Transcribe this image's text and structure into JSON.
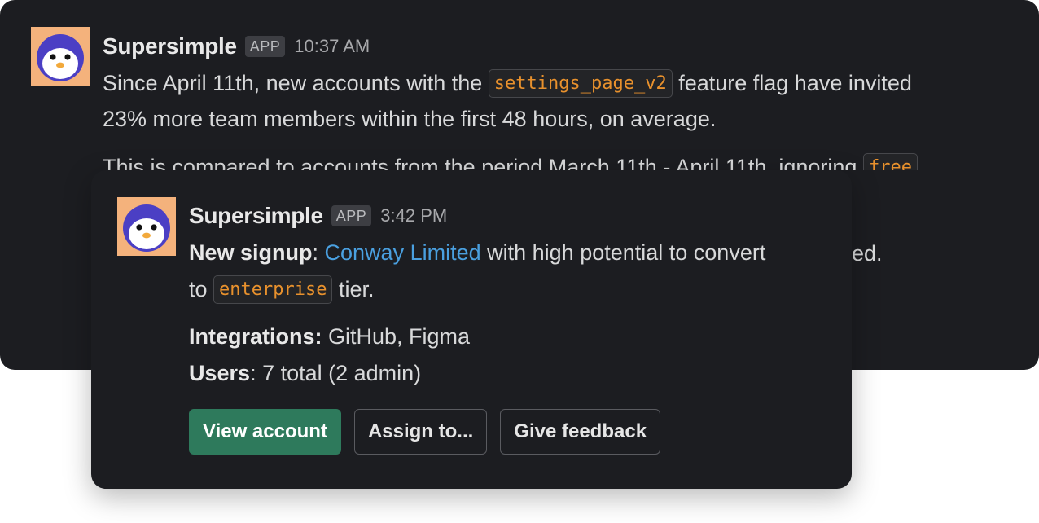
{
  "back_message": {
    "sender": "Supersimple",
    "badge": "APP",
    "time": "10:37 AM",
    "line1_pre": "Since April 11th, new accounts with the ",
    "line1_code": "settings_page_v2",
    "line1_post": " feature flag have invited",
    "line2": "23% more team members within the first 48 hours, on average.",
    "line3_pre": "This is compared to accounts from the period March 11th - April 11th, ignoring ",
    "line3_code": "free",
    "peek": "ed."
  },
  "front_message": {
    "sender": "Supersimple",
    "badge": "APP",
    "time": "3:42 PM",
    "signup_label": "New signup",
    "signup_sep": ": ",
    "company": "Conway Limited",
    "signup_rest": " with high potential to convert",
    "line2_pre": "to ",
    "tier_code": "enterprise",
    "line2_post": " tier.",
    "integrations_label": "Integrations:",
    "integrations_value": " GitHub, Figma",
    "users_label": "Users",
    "users_value": ": 7 total (2 admin)",
    "buttons": {
      "view_account": "View account",
      "assign": "Assign to...",
      "feedback": "Give feedback"
    }
  },
  "colors": {
    "card_bg": "#1c1d21",
    "code_text": "#e8912d",
    "link": "#4aa0e0",
    "primary_button": "#2e7a5c",
    "avatar_bg": "#f4b27c"
  },
  "icons": {
    "avatar": "penguin-avatar-icon"
  }
}
